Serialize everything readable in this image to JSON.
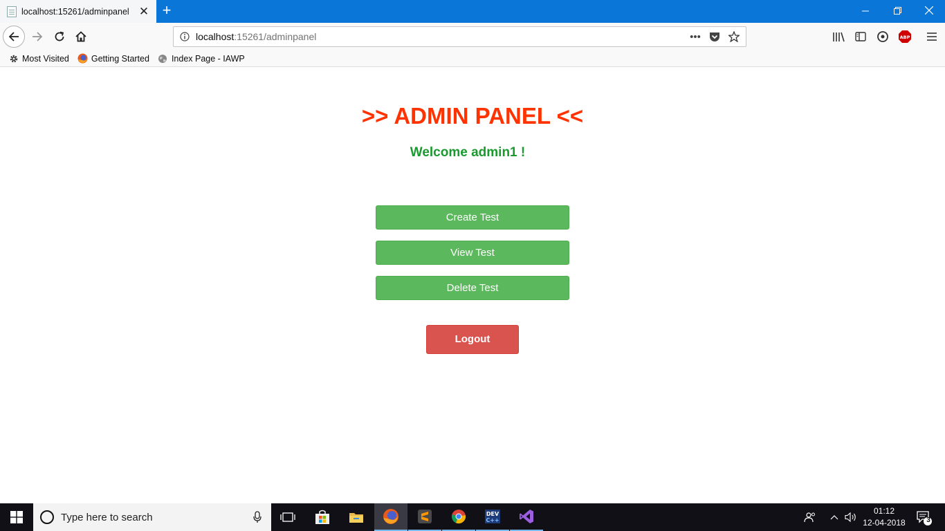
{
  "browser": {
    "tab_title": "localhost:15261/adminpanel",
    "url_host": "localhost",
    "url_rest": ":15261/adminpanel",
    "bookmarks": [
      {
        "label": "Most Visited",
        "icon": "gear-icon"
      },
      {
        "label": "Getting Started",
        "icon": "firefox-icon"
      },
      {
        "label": "Index Page - IAWP",
        "icon": "globe-icon"
      }
    ]
  },
  "page": {
    "title": ">> ADMIN PANEL <<",
    "welcome": "Welcome admin1 !",
    "buttons": {
      "create": "Create Test",
      "view": "View Test",
      "delete": "Delete Test",
      "logout": "Logout"
    },
    "colors": {
      "title": "#ff3300",
      "welcome": "#1a9a2e",
      "action_button": "#5cb85c",
      "logout_button": "#d9534f"
    }
  },
  "taskbar": {
    "search_placeholder": "Type here to search",
    "time": "01:12",
    "date": "12-04-2018",
    "notification_count": "3"
  }
}
